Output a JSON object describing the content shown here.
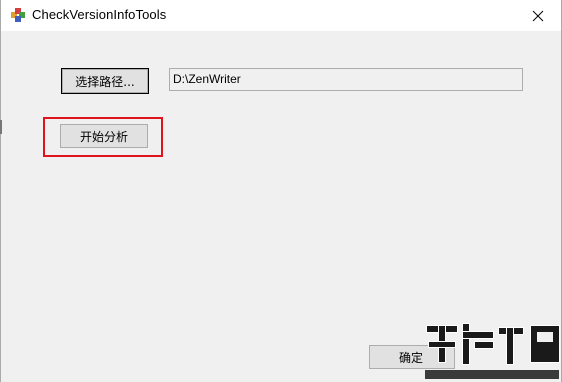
{
  "window": {
    "title": "CheckVersionInfoTools",
    "app_icon": "cube-app-icon",
    "close_icon": "close-icon"
  },
  "main": {
    "browse_button_label": "选择路径...",
    "path_value": "D:\\ZenWriter",
    "analyze_button_label": "开始分析",
    "ok_button_label": "确定"
  },
  "colors": {
    "highlight": "#e0141c",
    "window_bg": "#f0f0f0"
  }
}
